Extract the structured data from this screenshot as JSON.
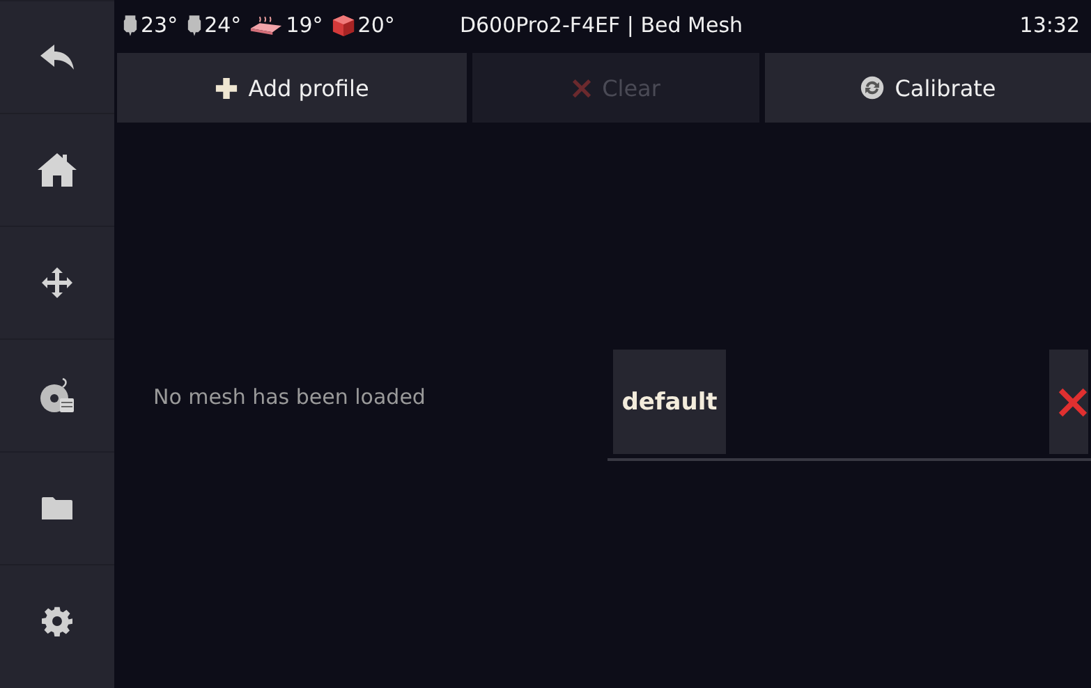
{
  "sidebar": {
    "items": [
      {
        "kind": "back"
      },
      {
        "kind": "home"
      },
      {
        "kind": "move"
      },
      {
        "kind": "filament"
      },
      {
        "kind": "files"
      },
      {
        "kind": "settings"
      }
    ]
  },
  "top_bar": {
    "temperatures": [
      {
        "kind": "extruder",
        "reading": "23°"
      },
      {
        "kind": "extruder",
        "reading": "24°"
      },
      {
        "kind": "bed",
        "reading": "19°"
      },
      {
        "kind": "chamber",
        "reading": "20°"
      }
    ],
    "title": "D600Pro2-F4EF | Bed Mesh",
    "time": "13:32"
  },
  "actions": [
    {
      "kind": "add",
      "label": "Add profile",
      "disabled": false
    },
    {
      "kind": "clear",
      "label": "Clear",
      "disabled": true
    },
    {
      "kind": "calibrate",
      "label": "Calibrate",
      "disabled": false
    }
  ],
  "message": "No mesh has been loaded",
  "profiles": [
    {
      "name": "default"
    }
  ]
}
